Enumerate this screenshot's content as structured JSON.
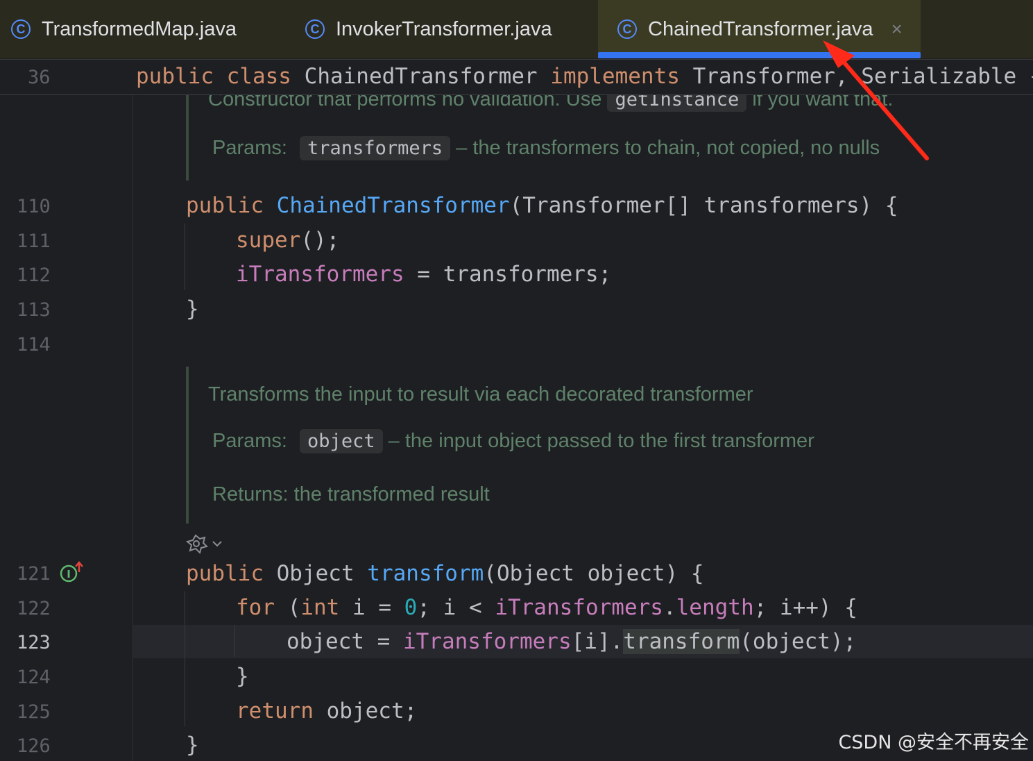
{
  "tabs": [
    {
      "label": "TransformedMap.java",
      "icon": "java-class-icon"
    },
    {
      "label": "InvokerTransformer.java",
      "icon": "java-class-icon"
    },
    {
      "label": "ChainedTransformer.java",
      "icon": "java-class-icon",
      "active": true,
      "close_glyph": "×"
    }
  ],
  "sticky": {
    "line_number": "36",
    "kw1": "public",
    "kw2": "class",
    "name": "ChainedTransformer",
    "kw3": "implements",
    "rest": "Transformer, Serializable {"
  },
  "doc1": {
    "line_a_text": "Constructor that performs no validation. Use",
    "line_a_code": "getInstance",
    "line_a_tail": "if you want that.",
    "params_label": "Params:",
    "param_name": "transformers",
    "param_desc": "– the transformers to chain, not copied, no nulls"
  },
  "doc2": {
    "summary": "Transforms the input to result via each decorated transformer",
    "params_label": "Params:",
    "param_name": "object",
    "param_desc": "– the input object passed to the first transformer",
    "returns": "Returns: the transformed result"
  },
  "line_numbers": {
    "l110": "110",
    "l111": "111",
    "l112": "112",
    "l113": "113",
    "l114": "114",
    "l121": "121",
    "l122": "122",
    "l123": "123",
    "l124": "124",
    "l125": "125",
    "l126": "126"
  },
  "code": {
    "c110_kw": "public",
    "c110_fn": "ChainedTransformer",
    "c110_rest": "(Transformer[] transformers) {",
    "c111_kw": "super",
    "c111_rest": "();",
    "c112_fld": "iTransformers",
    "c112_rest": " = transformers;",
    "c113": "}",
    "c121_kw": "public",
    "c121_type": " Object ",
    "c121_fn": "transform",
    "c121_rest": "(Object object) {",
    "c122_kw1": "for",
    "c122_p1": " (",
    "c122_kw2": "int",
    "c122_p2": " i = ",
    "c122_num": "0",
    "c122_p3": "; i < ",
    "c122_fld1": "iTransformers",
    "c122_p4": ".",
    "c122_fld2": "length",
    "c122_p5": "; i++) {",
    "c123_p1": "object = ",
    "c123_fld": "iTransformers",
    "c123_p2": "[i].",
    "c123_call": "transform",
    "c123_p3": "(object);",
    "c124": "}",
    "c125_kw": "return",
    "c125_rest": " object;",
    "c126": "}"
  },
  "watermark": "CSDN @安全不再安全",
  "colors": {
    "keyword": "#cf8e6d",
    "function": "#56a8f5",
    "field": "#c77dbb",
    "number": "#2aacb8",
    "doc": "#5f826b",
    "tab_accent": "#3574f0",
    "annotation_arrow": "#ff2a1a"
  }
}
